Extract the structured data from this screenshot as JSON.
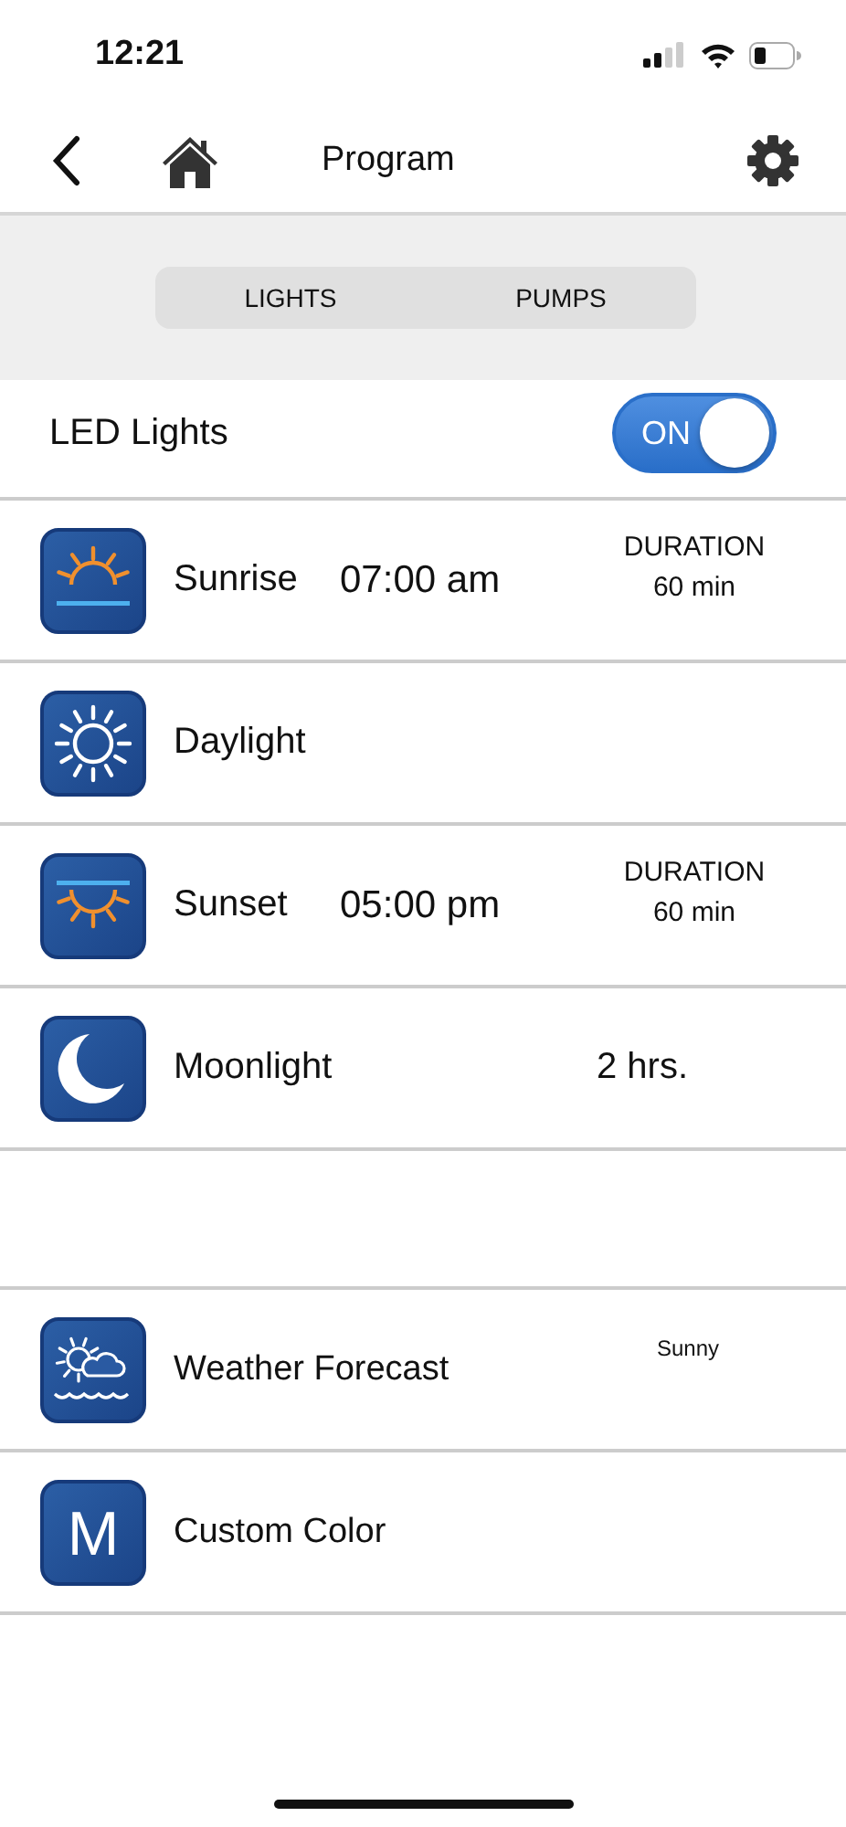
{
  "status_bar": {
    "time": "12:21"
  },
  "nav": {
    "title": "Program"
  },
  "tabs": [
    {
      "label": "LIGHTS"
    },
    {
      "label": "PUMPS"
    }
  ],
  "master": {
    "label": "LED Lights",
    "on": true,
    "state_text": "ON"
  },
  "programs": [
    {
      "kind": "sunrise",
      "name": "Sunrise",
      "time": "07:00 am",
      "duration_label": "DURATION",
      "duration": "60 min"
    },
    {
      "kind": "daylight",
      "name": "Daylight"
    },
    {
      "kind": "sunset",
      "name": "Sunset",
      "time": "05:00 pm",
      "duration_label": "DURATION",
      "duration": "60 min"
    },
    {
      "kind": "moonlight",
      "name": "Moonlight",
      "length": "2 hrs."
    }
  ],
  "extras": [
    {
      "kind": "weather",
      "name": "Weather Forecast",
      "note": "Sunny"
    },
    {
      "kind": "letter",
      "icon_letter": "M",
      "name": "Custom Color"
    }
  ]
}
